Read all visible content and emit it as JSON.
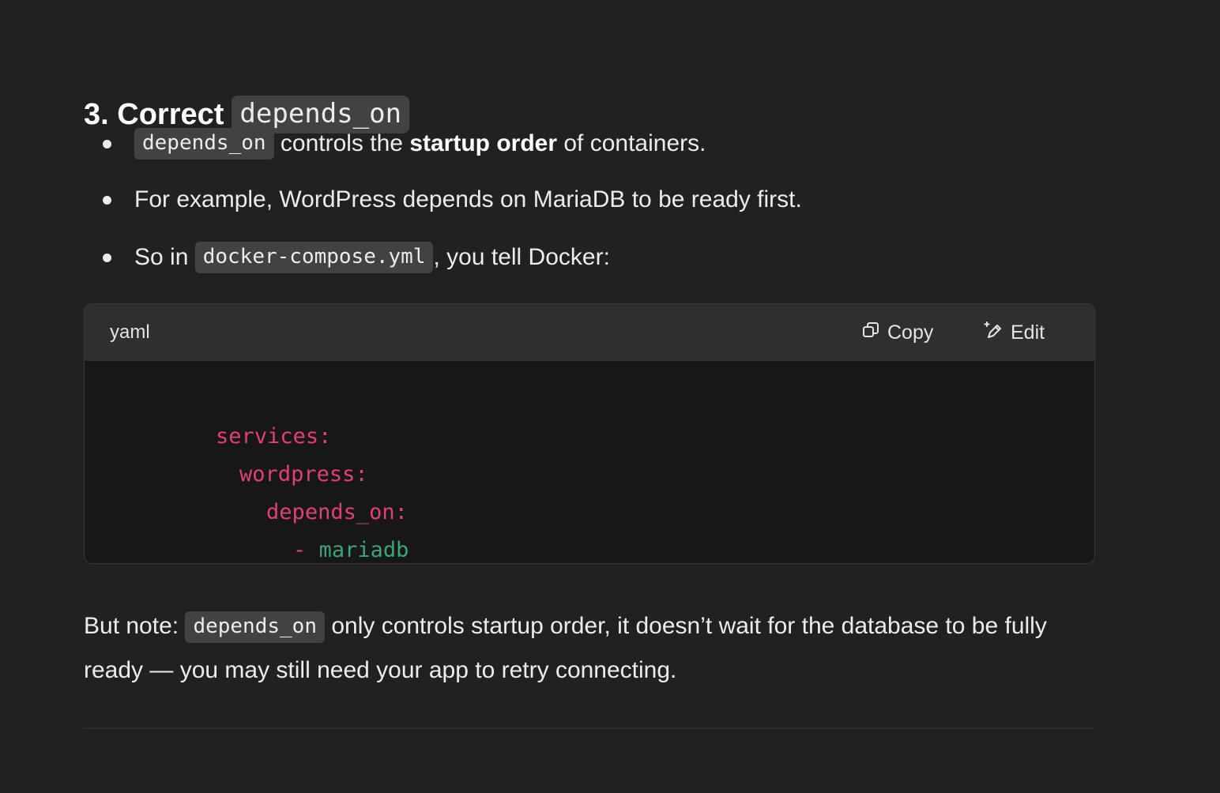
{
  "heading": {
    "prefix": "3. Correct",
    "code": "depends_on"
  },
  "bullets": [
    {
      "code": "depends_on",
      "text_before_bold": " controls the ",
      "bold": "startup order",
      "text_after_bold": " of containers."
    },
    {
      "text": "For example, WordPress depends on MariaDB to be ready first."
    },
    {
      "text_before_code": "So in ",
      "code": "docker-compose.yml",
      "text_after_code": ", you tell Docker:"
    }
  ],
  "codeblock": {
    "language": "yaml",
    "copy_label": "Copy",
    "edit_label": "Edit",
    "lines": [
      {
        "key": "services:"
      },
      {
        "key": "wordpress:"
      },
      {
        "key": "depends_on:"
      },
      {
        "dash": "-",
        "value": "mariadb"
      }
    ]
  },
  "note": {
    "prefix": "But note: ",
    "code": "depends_on",
    "suffix": " only controls startup order, it doesn’t wait for the database to be fully ready — you may still need your app to retry connecting."
  },
  "colors": {
    "background": "#212121",
    "code_key": "#e23f74",
    "code_string": "#3fa37a",
    "inline_code_bg": "#424242"
  }
}
